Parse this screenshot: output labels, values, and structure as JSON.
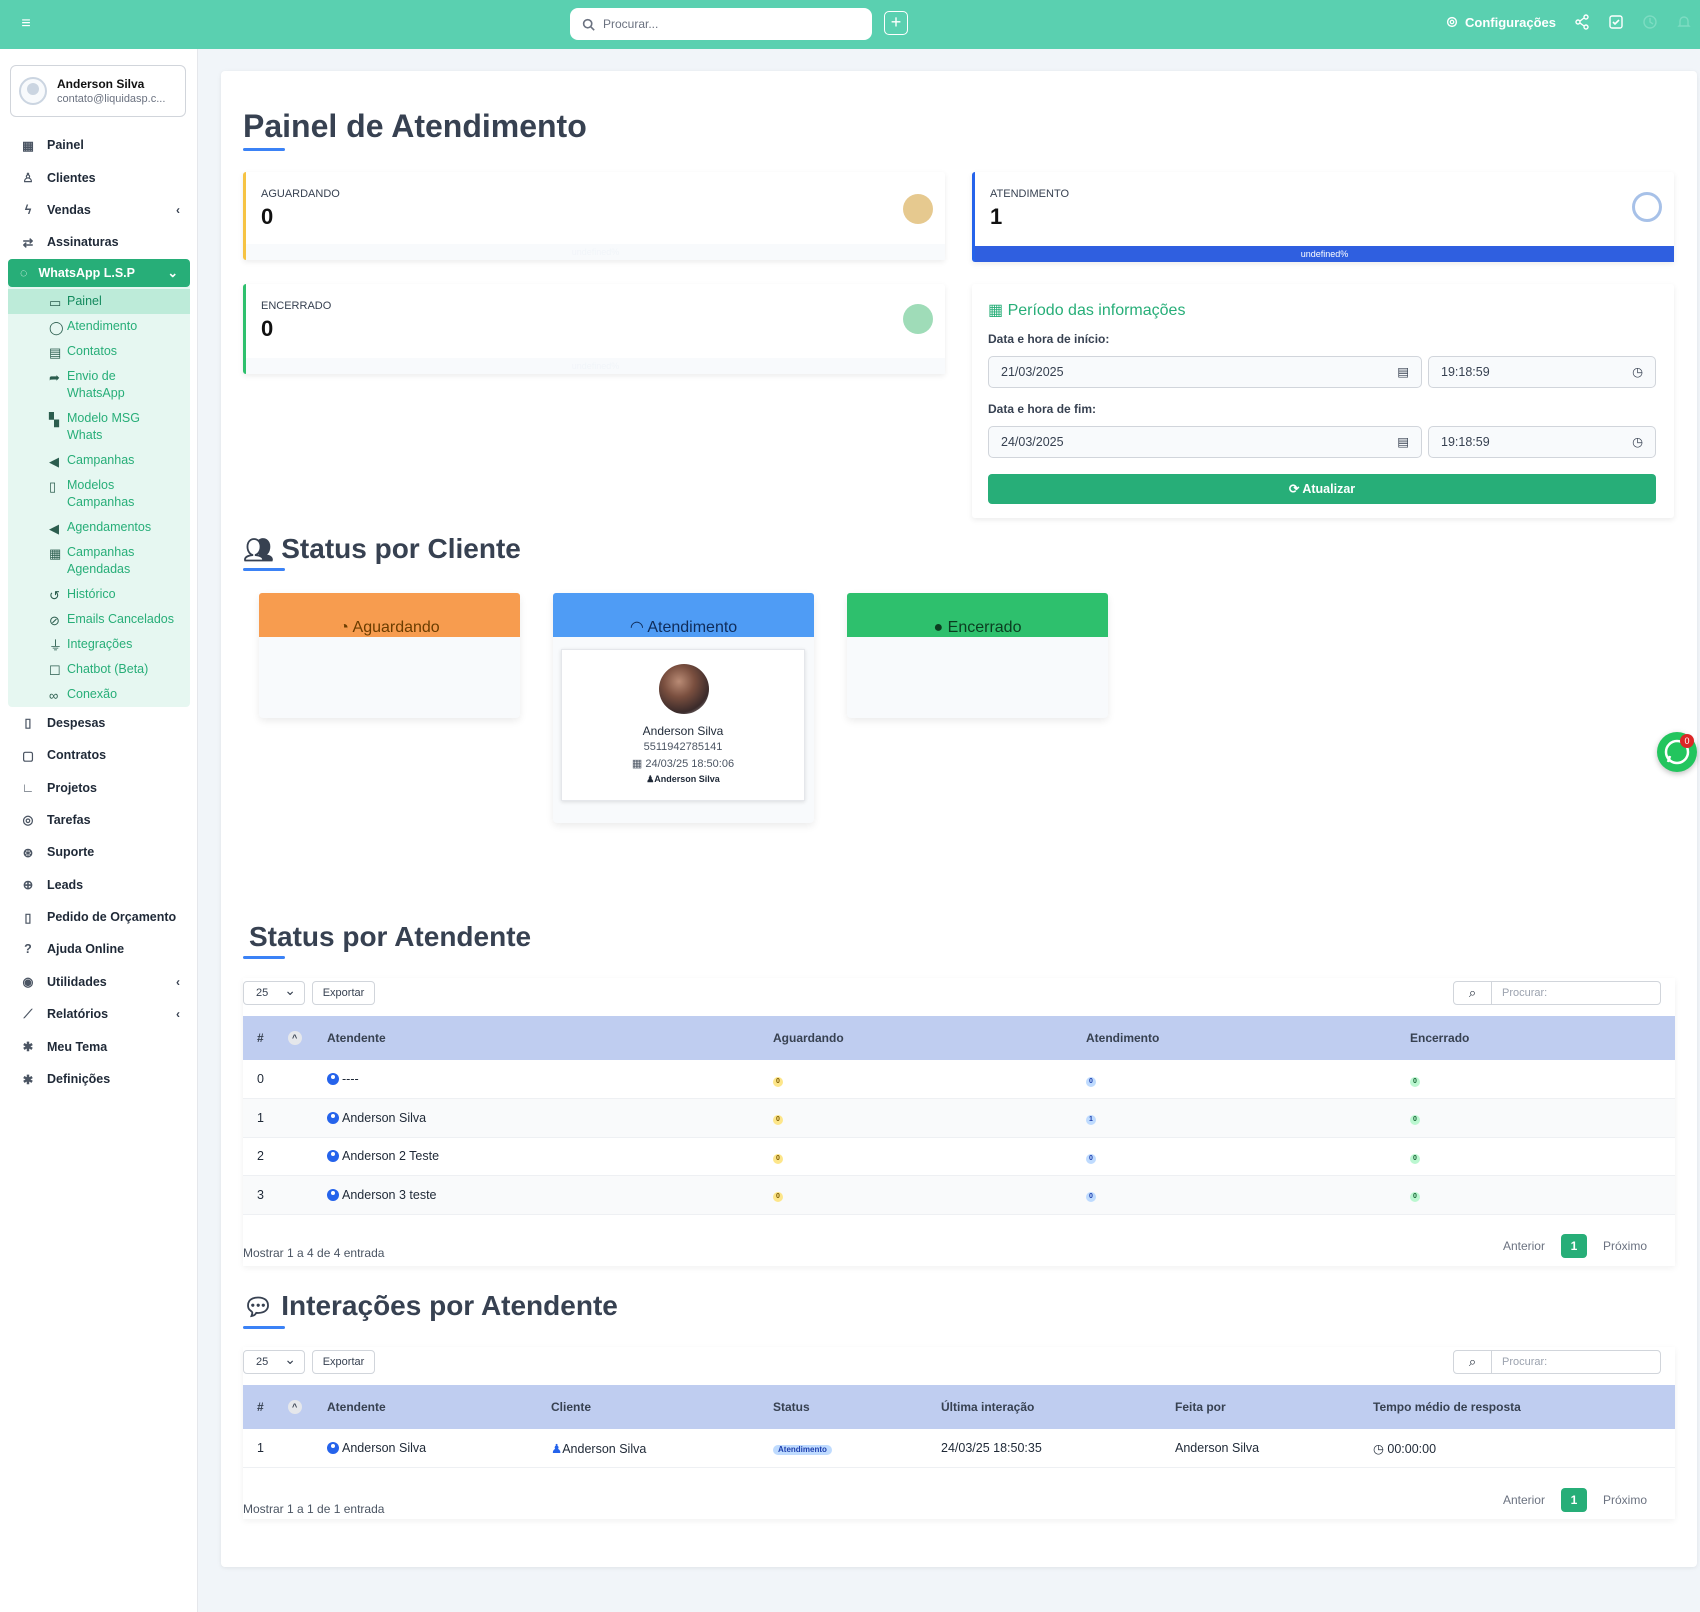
{
  "topbar": {
    "search_placeholder": "Procurar...",
    "config_label": "Configurações"
  },
  "user": {
    "name": "Anderson Silva",
    "email": "contato@liquidasp.c..."
  },
  "nav": {
    "painel": "Painel",
    "clientes": "Clientes",
    "vendas": "Vendas",
    "assinaturas": "Assinaturas",
    "whatsapp": "WhatsApp L.S.P",
    "wa_items": [
      "Painel",
      "Atendimento",
      "Contatos",
      "Envio de WhatsApp",
      "Modelo MSG Whats",
      "Campanhas",
      "Modelos Campanhas",
      "Agendamentos",
      "Campanhas Agendadas",
      "Histórico",
      "Emails Cancelados",
      "Integrações",
      "Chatbot (Beta)",
      "Conexão"
    ],
    "despesas": "Despesas",
    "contratos": "Contratos",
    "projetos": "Projetos",
    "tarefas": "Tarefas",
    "suporte": "Suporte",
    "leads": "Leads",
    "pedido": "Pedido de Orçamento",
    "ajuda": "Ajuda Online",
    "utilidades": "Utilidades",
    "relatorios": "Relatórios",
    "meu_tema": "Meu Tema",
    "definicoes": "Definições"
  },
  "page_title": "Painel de Atendimento",
  "stats": {
    "aguardando": {
      "label": "AGUARDANDO",
      "value": "0",
      "bar": "undefined%"
    },
    "atendimento": {
      "label": "ATENDIMENTO",
      "value": "1",
      "bar": "undefined%"
    },
    "encerrado": {
      "label": "ENCERRADO",
      "value": "0",
      "bar": "undefined%"
    }
  },
  "periodo": {
    "title": "Período das informações",
    "start_label": "Data e hora de início:",
    "start_date": "21/03/2025",
    "start_time": "19:18:59",
    "end_label": "Data e hora de fim:",
    "end_date": "24/03/2025",
    "end_time": "19:18:59",
    "update_button": "Atualizar"
  },
  "status_cliente": {
    "title": "Status por Cliente",
    "cols": {
      "aguardando": "Aguardando",
      "atendimento": "Atendimento",
      "encerrado": "Encerrado"
    },
    "card": {
      "name": "Anderson Silva",
      "phone": "5511942785141",
      "date": "24/03/25 18:50:06",
      "by": "Anderson Silva"
    }
  },
  "status_atendente": {
    "title": "Status por Atendente",
    "page_size": "25",
    "export": "Exportar",
    "search_placeholder": "Procurar:",
    "headers": [
      "#",
      "Atendente",
      "Aguardando",
      "Atendimento",
      "Encerrado"
    ],
    "rows": [
      {
        "n": "0",
        "name": "----",
        "ag": "0",
        "at": "0",
        "en": "0"
      },
      {
        "n": "1",
        "name": "Anderson Silva",
        "ag": "0",
        "at": "1",
        "en": "0"
      },
      {
        "n": "2",
        "name": "Anderson 2 Teste",
        "ag": "0",
        "at": "0",
        "en": "0"
      },
      {
        "n": "3",
        "name": "Anderson 3 teste",
        "ag": "0",
        "at": "0",
        "en": "0"
      }
    ],
    "footer": "Mostrar 1 a 4 de 4 entrada",
    "prev": "Anterior",
    "page": "1",
    "next": "Próximo"
  },
  "interacoes": {
    "title": "Interações por Atendente",
    "page_size": "25",
    "export": "Exportar",
    "search_placeholder": "Procurar:",
    "headers": [
      "#",
      "Atendente",
      "Cliente",
      "Status",
      "Última interação",
      "Feita por",
      "Tempo médio de resposta"
    ],
    "row": {
      "n": "1",
      "atendente": "Anderson Silva",
      "cliente": "Anderson Silva",
      "status": "Atendimento",
      "ultima": "24/03/25 18:50:35",
      "feita": "Anderson Silva",
      "tempo": "00:00:00"
    },
    "footer": "Mostrar 1 a 1 de 1 entrada",
    "prev": "Anterior",
    "page": "1",
    "next": "Próximo"
  },
  "wa_float_badge": "0",
  "colors": {
    "brand": "#5ad0b0",
    "green": "#27ae78",
    "header": "#bfcdf0",
    "orange": "#f79c4f",
    "blue": "#4f9cf5",
    "greenhead": "#2ec06d"
  }
}
